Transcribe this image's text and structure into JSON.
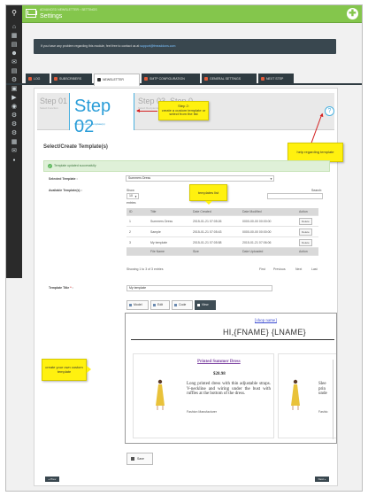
{
  "header": {
    "breadcrumb": "ADVANCED NEWSLETTER  ›  SETTINGS",
    "title": "Settings",
    "accent": "#84c64c"
  },
  "info": {
    "text": "If you have any problem regarding this module, feel free to contact us at",
    "email": "support@fmeaddons.com"
  },
  "tabs": [
    {
      "label": "LOG"
    },
    {
      "label": "SUBSCRIBERS"
    },
    {
      "label": "NEWSLETTER"
    },
    {
      "label": "SMTP CONFIGURATION"
    },
    {
      "label": "GENERAL SETTINGS"
    },
    {
      "label": "NEXT STEP"
    }
  ],
  "steps": {
    "step1": "Step 01",
    "step1_sub": "Select Function",
    "step2": "Step 02",
    "step2_sub": "Select/Create Template(s)",
    "step3": "Step 03",
    "step3_sub": "Select Recipients",
    "step4": "Step 0",
    "help": "?"
  },
  "callouts": {
    "step2": "Step 2:\ncreate a custom template or\nselect from the list",
    "help": "help regarding template",
    "templates": "templates list",
    "custom": "create your own custom\ntemplate"
  },
  "section": {
    "title": "Select/Create Template(s)",
    "success": "Template updated successfully"
  },
  "form": {
    "selected_label": "Selected Template :",
    "selected_value": "Summers Dress",
    "available_label": "Available Template(s) :",
    "show_label": "Show",
    "show_value": "10",
    "entries_label": "entries",
    "search_label": "Search:",
    "title_label": "Template Title",
    "title_value": "My template"
  },
  "table": {
    "headers": [
      "ID",
      "Title",
      "Date Created",
      "Date Modified",
      "Action"
    ],
    "footers": [
      "",
      "File Name",
      "Size",
      "Date Uploaded",
      "Action"
    ],
    "rows": [
      {
        "id": "1",
        "title": "Summers Dress",
        "created": "2015-01-21 07:05:26",
        "modified": "0000-00-00 00:00:00",
        "action": "Delete"
      },
      {
        "id": "2",
        "title": "Sample",
        "created": "2015-01-21 07:05:43",
        "modified": "0000-00-00 00:00:00",
        "action": "Delete"
      },
      {
        "id": "3",
        "title": "My template",
        "created": "2015-01-21 07:05:58",
        "modified": "2015-01-21 07:06:06",
        "action": "Delete"
      }
    ],
    "showing": "Showing 1 to 3 of 3 entries",
    "pager": {
      "first": "First",
      "previous": "Previous",
      "next": "Next",
      "last": "Last"
    }
  },
  "editor": {
    "buttons": [
      {
        "label": "Model"
      },
      {
        "label": "Edit"
      },
      {
        "label": "Code"
      },
      {
        "label": "View"
      }
    ]
  },
  "preview": {
    "shop_link": "[shop name]",
    "greeting": "HI,{FNAME} {LNAME}",
    "product_name": "Printed Summer Dress",
    "price": "$28.98",
    "description": "Long printed dress with thin adjustable straps. V-neckline and wiring under the bust with ruffles at the bottom of the dress.",
    "manufacturer": "Fashion Manufacturer",
    "partial_desc": "Slee\nprin\nunde",
    "partial_mfr": "Fashio"
  },
  "save_label": "Save",
  "nav": {
    "prev": "« Prev",
    "next": "Next »"
  }
}
